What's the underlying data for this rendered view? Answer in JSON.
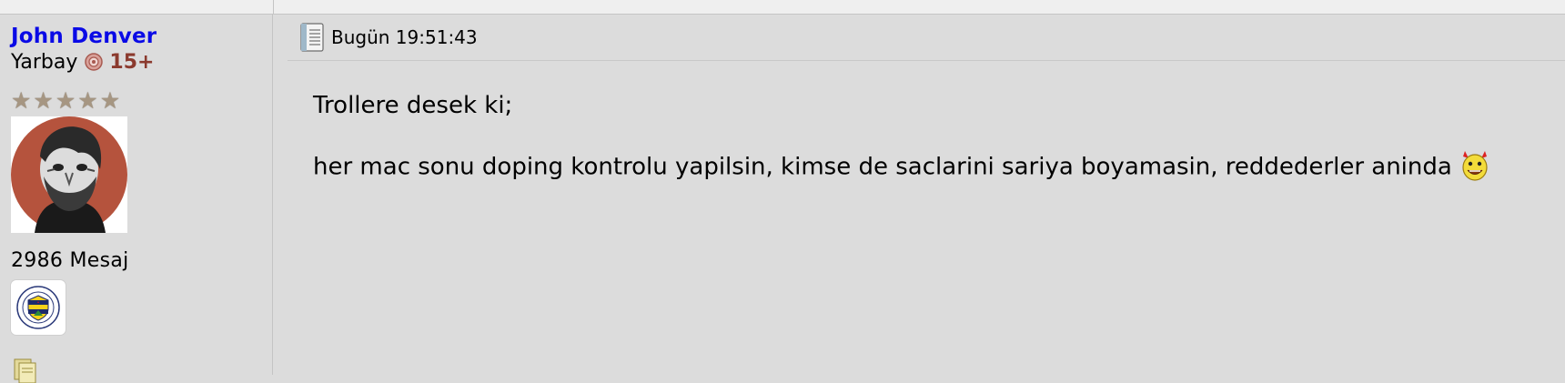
{
  "author": {
    "username": "John Denver",
    "rank": "Yarbay",
    "rank_level": "15+",
    "rank_icon": "rank-medal-icon",
    "stars": [
      "★",
      "★",
      "★",
      "★",
      "★"
    ],
    "post_count": "2986 Mesaj",
    "club_badge": "fenerbahce-badge-icon"
  },
  "post": {
    "date": "Bugün 19:51:43",
    "lines": [
      "Trollere desek ki;",
      "her mac sonu doping kontrolu yapilsin, kimse de saclarini sariya boyamasin, reddederler aninda"
    ],
    "emoticon": "devil-smiley-icon"
  },
  "colors": {
    "username": "#0a0ae6",
    "rank_level": "#8b3a2e",
    "background": "#dcdcdc"
  }
}
